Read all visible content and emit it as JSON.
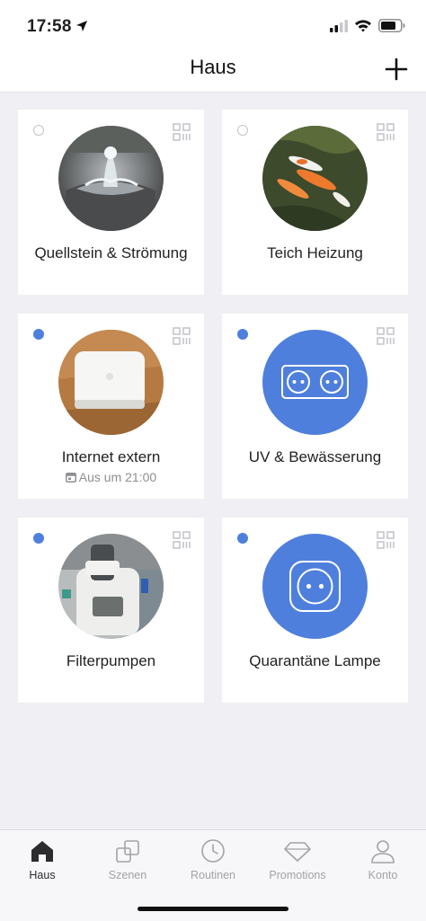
{
  "status_bar": {
    "time": "17:58"
  },
  "header": {
    "title": "Haus"
  },
  "devices": [
    {
      "name": "Quellstein & Strömung",
      "online": false,
      "image": "fountain-stone-photo"
    },
    {
      "name": "Teich Heizung",
      "online": false,
      "image": "koi-pond-photo"
    },
    {
      "name": "Internet extern",
      "online": true,
      "image": "router-photo",
      "schedule": "Aus um 21:00"
    },
    {
      "name": "UV & Bewässerung",
      "online": true,
      "image": "double-socket-icon"
    },
    {
      "name": "Filterpumpen",
      "online": true,
      "image": "plug-device-photo"
    },
    {
      "name": "Quarantäne Lampe",
      "online": true,
      "image": "single-socket-icon"
    }
  ],
  "tabbar": {
    "tabs": [
      {
        "label": "Haus",
        "icon": "house-icon",
        "active": true
      },
      {
        "label": "Szenen",
        "icon": "scenes-icon",
        "active": false
      },
      {
        "label": "Routinen",
        "icon": "clock-icon",
        "active": false
      },
      {
        "label": "Promotions",
        "icon": "diamond-icon",
        "active": false
      },
      {
        "label": "Konto",
        "icon": "person-icon",
        "active": false
      }
    ]
  },
  "colors": {
    "accent": "#4f7fdc",
    "background": "#f0f0f4",
    "card": "#ffffff"
  }
}
